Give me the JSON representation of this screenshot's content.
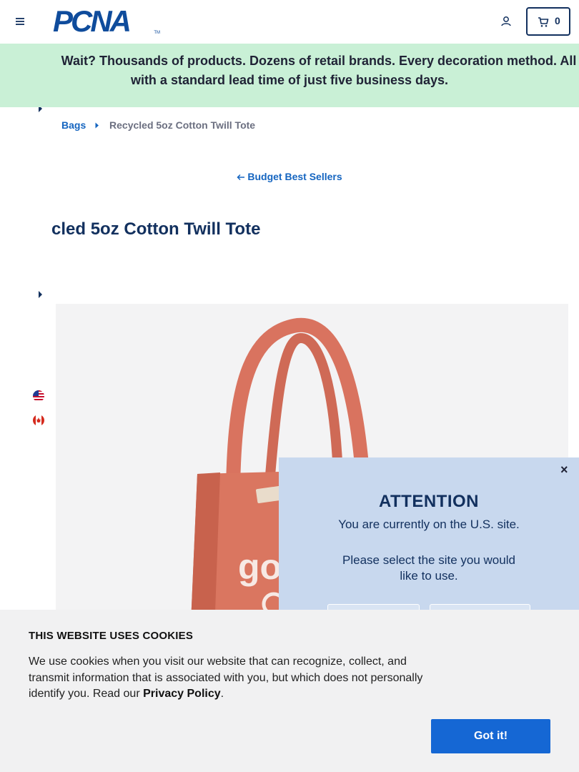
{
  "header": {
    "logo_text": "PCNA",
    "logo_tm": "TM",
    "cart_count": "0"
  },
  "promo": {
    "line1": "Wait? Thousands of products. Dozens of retail brands. Every decoration method. All",
    "line2": "with a standard lead time of just five business days."
  },
  "breadcrumb": {
    "parent": "Bags",
    "current": "Recycled 5oz Cotton Twill Tote"
  },
  "back_link": {
    "label": "Budget Best Sellers"
  },
  "product": {
    "title": "cled 5oz Cotton Twill Tote"
  },
  "modal": {
    "close": "×",
    "title": "ATTENTION",
    "message": "You are currently on the U.S. site.",
    "prompt": "Please select the site you would like to use."
  },
  "cookie": {
    "title": "THIS WEBSITE USES COOKIES",
    "body": "We use cookies when you visit our website that can recognize, collect, and transmit information that is associated with you, but which does not personally identify you. Read our",
    "link": "Privacy Policy",
    "period": ".",
    "button": "Got it!"
  },
  "icons": [
    "menu-icon",
    "account-icon",
    "cart-icon",
    "caret-right-icon",
    "arrow-left-icon",
    "us-flag-icon",
    "canada-flag-icon",
    "close-icon"
  ],
  "colors": {
    "brand_blue": "#0f4c9c",
    "link_blue": "#1565c0",
    "promo_green": "#c9f0d6",
    "modal_bg": "#c8d8ee",
    "tote_red": "#d9735f",
    "button_blue": "#1567d4"
  }
}
